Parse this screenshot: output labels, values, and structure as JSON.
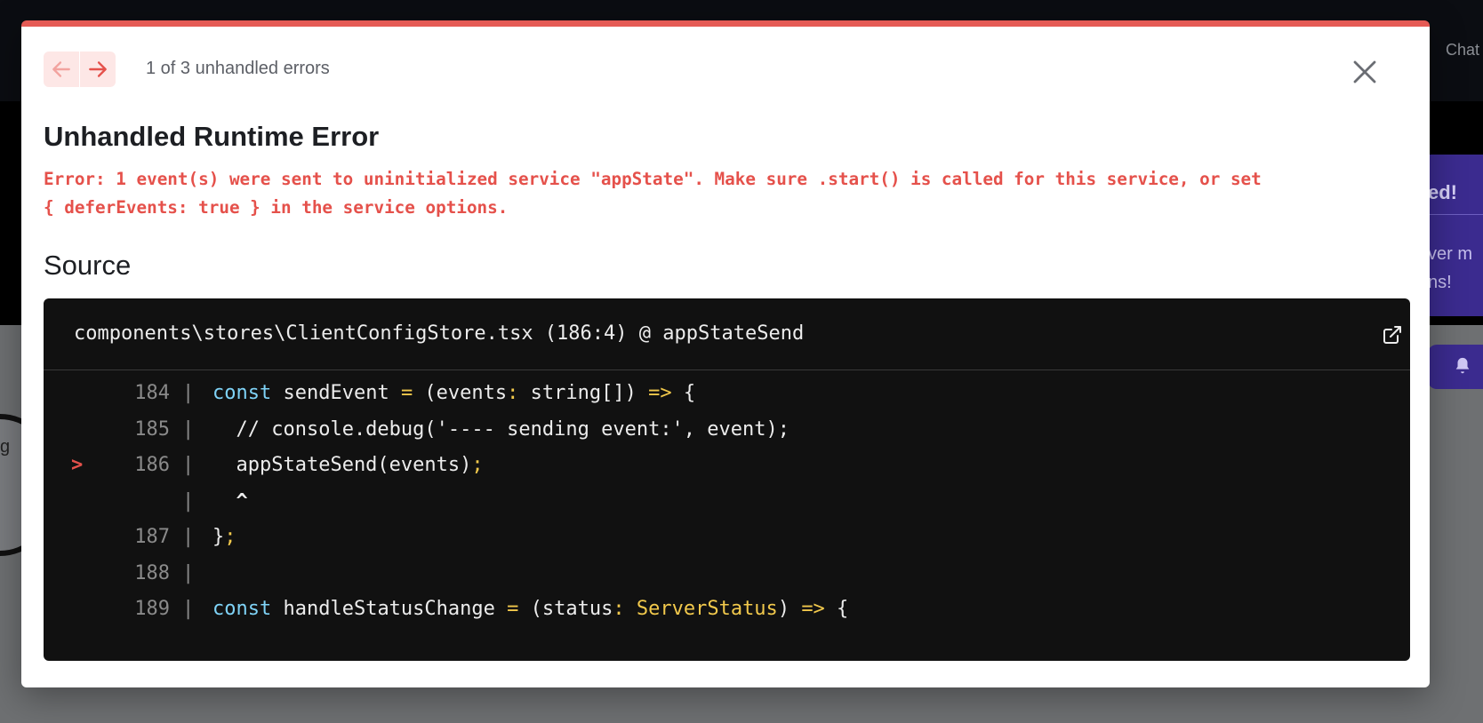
{
  "background": {
    "chat_link": "Chat",
    "card_title": "ed!",
    "card_body": "ver m\nns!",
    "circle_text": "g"
  },
  "overlay": {
    "pagination": "1 of 3 unhandled errors",
    "nav_prev_icon": "arrow-left-icon",
    "nav_next_icon": "arrow-right-icon",
    "close_icon": "close-icon",
    "title": "Unhandled Runtime Error",
    "message_line1": "Error: 1 event(s) were sent to uninitialized service \"appState\". Make sure .start() is called for this service, or set",
    "message_line2": "{ deferEvents: true } in the service options.",
    "source_heading": "Source",
    "code_frame": {
      "file": "components\\stores\\ClientConfigStore.tsx (186:4) @ appStateSend",
      "open_icon": "external-link-icon",
      "lines": [
        {
          "no": "184",
          "marker": "",
          "code": "const sendEvent = (events: string[]) => {"
        },
        {
          "no": "185",
          "marker": "",
          "code": "  // console.debug('---- sending event:', event);"
        },
        {
          "no": "186",
          "marker": ">",
          "code": "  appStateSend(events);"
        },
        {
          "no": "",
          "marker": "",
          "code": "  ^"
        },
        {
          "no": "187",
          "marker": "",
          "code": "};"
        },
        {
          "no": "188",
          "marker": "",
          "code": ""
        },
        {
          "no": "189",
          "marker": "",
          "code": "const handleStatusChange = (status: ServerStatus) => {"
        }
      ]
    }
  },
  "colors": {
    "accent_red": "#e5514b",
    "code_bg": "#111111",
    "keyword": "#7fd3f7",
    "operator": "#f2c94c"
  }
}
